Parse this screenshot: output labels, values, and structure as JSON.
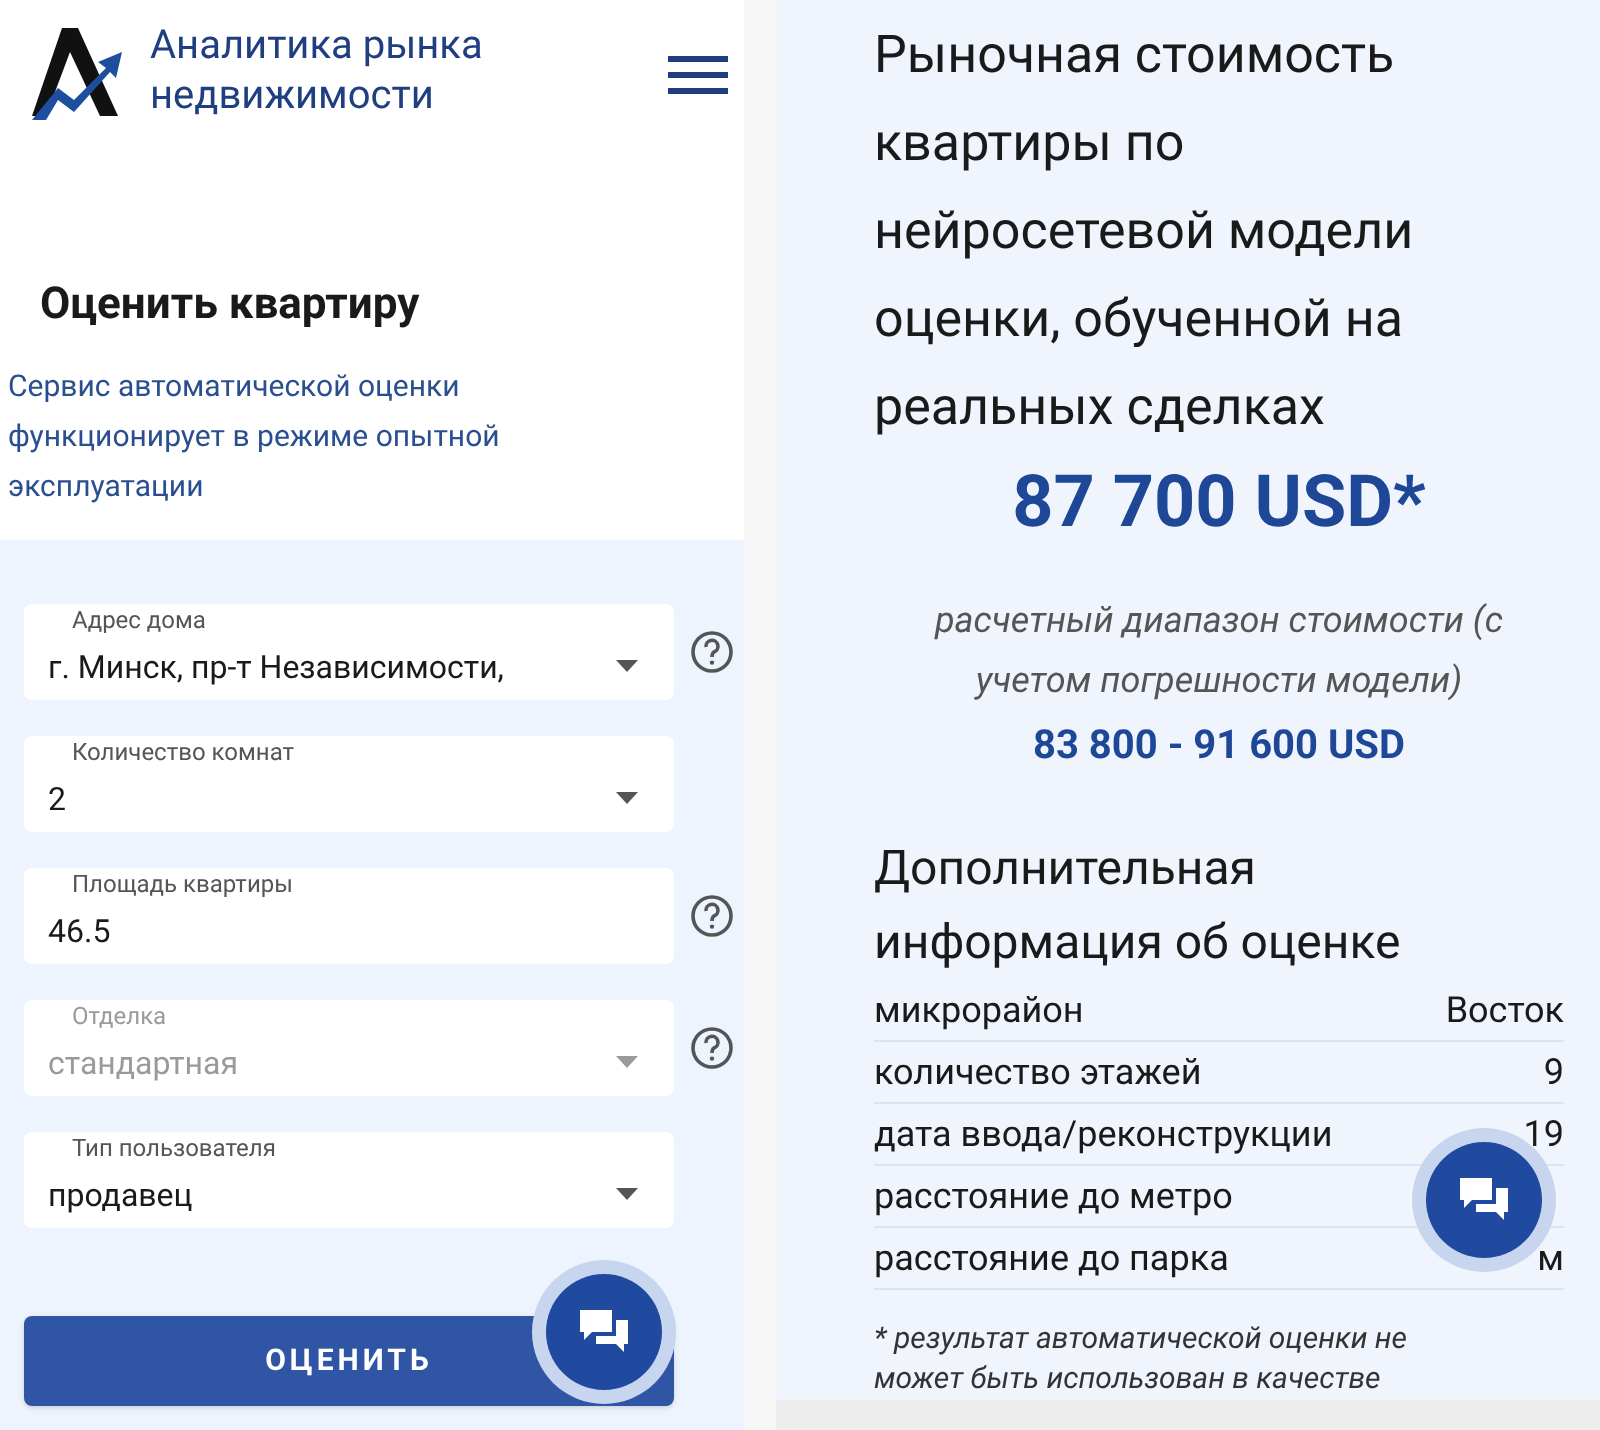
{
  "left": {
    "brand": "Аналитика рынка недвижимости",
    "heading": "Оценить квартиру",
    "notice": "Сервис автоматической оценки функционирует в режиме опытной эксплуатации",
    "fields": [
      {
        "kind": "select",
        "label": "Адрес дома",
        "value": "г. Минск, пр-т Независимости,",
        "disabled": false,
        "help": true
      },
      {
        "kind": "select",
        "label": "Количество комнат",
        "value": "2",
        "disabled": false,
        "help": false
      },
      {
        "kind": "input",
        "label": "Площадь квартиры",
        "value": "46.5",
        "disabled": false,
        "help": true
      },
      {
        "kind": "select",
        "label": "Отделка",
        "value": "стандартная",
        "disabled": true,
        "help": true
      },
      {
        "kind": "select",
        "label": "Тип пользователя",
        "value": "продавец",
        "disabled": false,
        "help": false
      }
    ],
    "submit": "ОЦЕНИТЬ"
  },
  "right": {
    "title": "Рыночная стоимость квартиры по нейросетевой модели оценки, обученной на реальных сделках",
    "price": "87 700 USD*",
    "range_note": "расчетный диапазон стоимости (с учетом погрешности модели)",
    "range": "83 800 - 91 600 USD",
    "info_title": "Дополнительная информация об оценке",
    "rows": [
      {
        "label": "микрорайон",
        "value": "Восток"
      },
      {
        "label": "количество этажей",
        "value": "9"
      },
      {
        "label": "дата ввода/реконструкции",
        "value": "19"
      },
      {
        "label": "расстояние до метро"
      },
      {
        "label": "расстояние до парка",
        "value": "м"
      }
    ],
    "footnote": "* результат автоматической оценки не может быть использован в качестве"
  }
}
